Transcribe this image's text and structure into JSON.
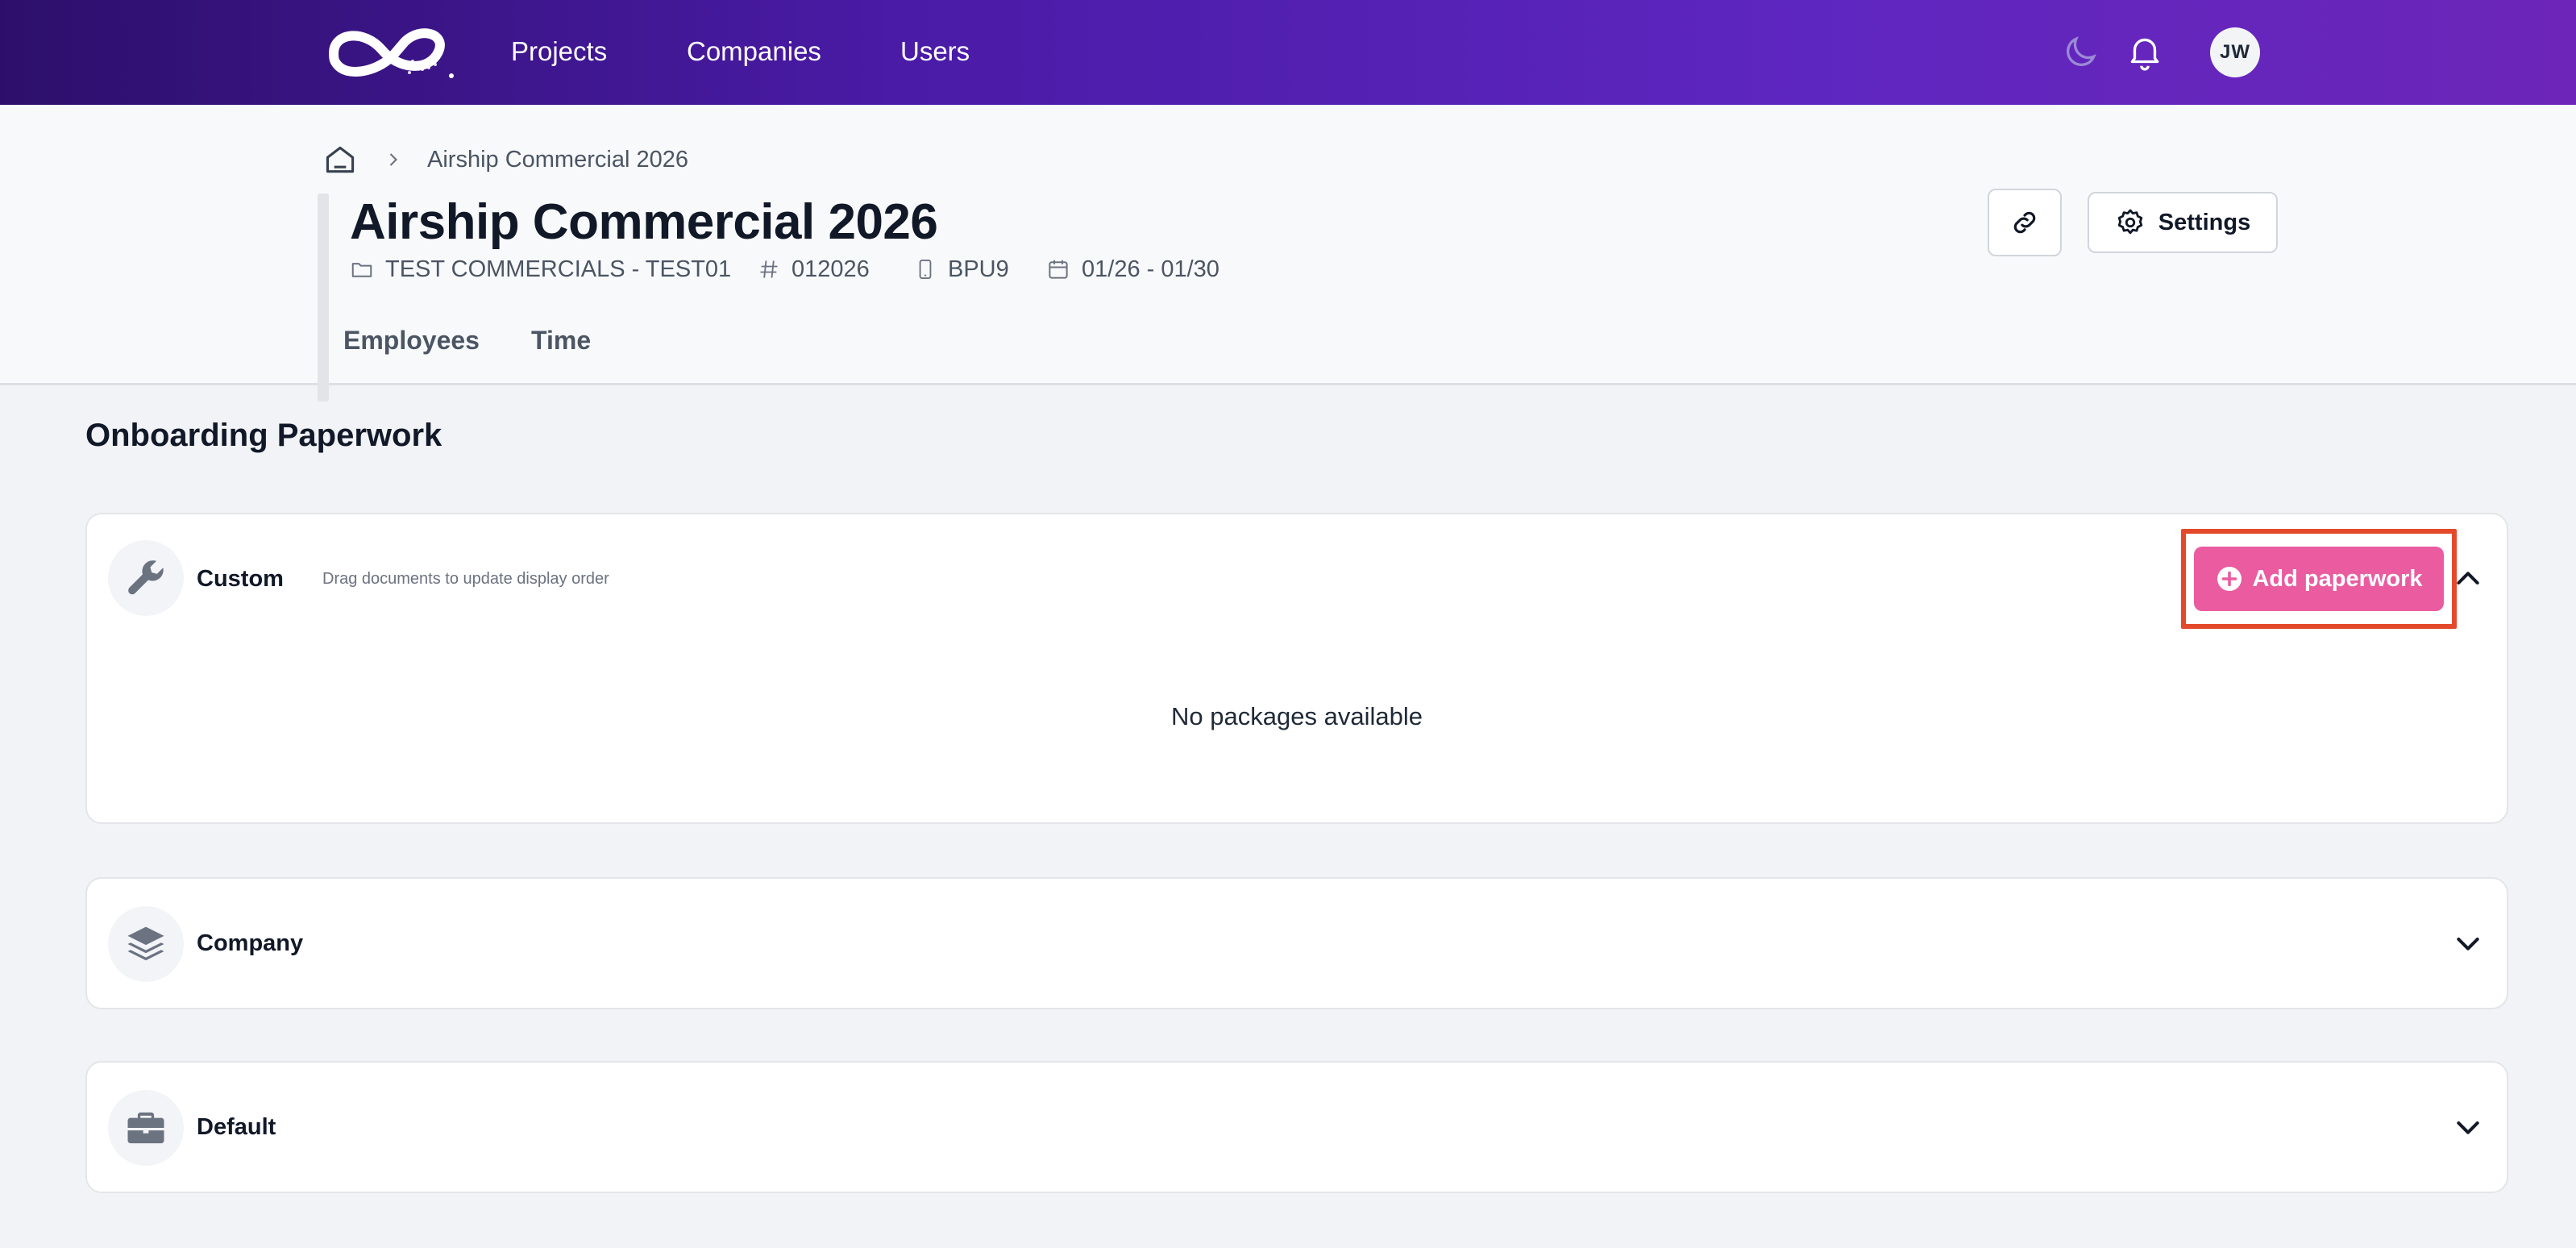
{
  "nav": {
    "links": [
      "Projects",
      "Companies",
      "Users"
    ],
    "avatar_initials": "JW"
  },
  "breadcrumb": {
    "current": "Airship Commercial 2026"
  },
  "project": {
    "title": "Airship Commercial 2026",
    "folder": "TEST COMMERCIALS - TEST01",
    "number": "012026",
    "code": "BPU9",
    "dates": "01/26 - 01/30"
  },
  "actions": {
    "settings_label": "Settings"
  },
  "tabs": [
    "Employees",
    "Time"
  ],
  "section": {
    "title": "Onboarding Paperwork"
  },
  "cards": {
    "custom": {
      "label": "Custom",
      "hint": "Drag documents to update display order",
      "add_label": "Add paperwork",
      "empty": "No packages available"
    },
    "company": {
      "label": "Company"
    },
    "default": {
      "label": "Default"
    }
  },
  "colors": {
    "nav_gradient_start": "#2d0f6b",
    "nav_gradient_end": "#6c25b8",
    "add_button": "#ea5b9f",
    "highlight_outline": "#e3492a",
    "page_background": "#f2f3f7"
  },
  "icons": {
    "logo": "brand-infinity-logo",
    "theme": "moon-icon",
    "notifications": "bell-icon",
    "home": "home-icon",
    "folder": "folder-icon",
    "hash": "hash-icon",
    "device": "phone-icon",
    "calendar": "calendar-icon",
    "link": "link-icon",
    "settings": "gear-icon",
    "custom": "wrench-icon",
    "company": "layers-icon",
    "default": "briefcase-icon"
  }
}
